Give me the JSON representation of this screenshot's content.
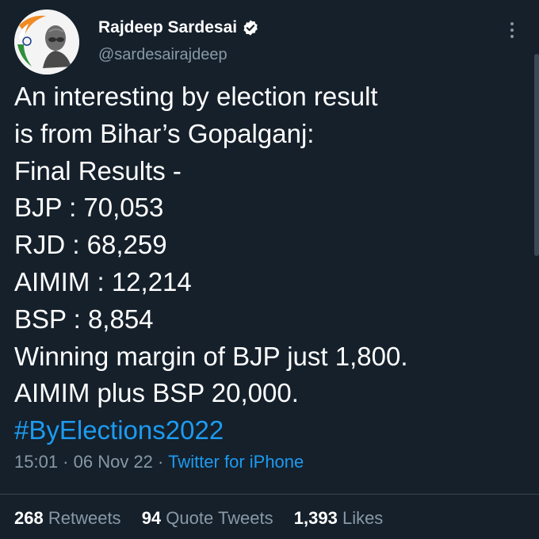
{
  "author": {
    "display_name": "Rajdeep Sardesai",
    "handle": "@sardesairajdeep",
    "verified_icon": "verified-badge-icon",
    "avatar": "profile-picture"
  },
  "tweet": {
    "lines": [
      "An interesting by election result",
      "is from Bihar’s Gopalganj:",
      "Final Results -",
      "BJP : 70,053",
      "RJD : 68,259",
      "AIMIM : 12,214",
      "BSP : 8,854",
      "Winning margin of BJP just 1,800.",
      "AIMIM plus BSP 20,000."
    ],
    "hashtag": "#ByElections2022"
  },
  "meta": {
    "time": "15:01",
    "separator": " · ",
    "date": "06 Nov 22",
    "source": "Twitter for iPhone"
  },
  "stats": {
    "retweets_count": "268",
    "retweets_label": "Retweets",
    "quotes_count": "94",
    "quotes_label": "Quote Tweets",
    "likes_count": "1,393",
    "likes_label": "Likes"
  },
  "colors": {
    "background": "#15202b",
    "text": "#ffffff",
    "secondary": "#8899a6",
    "link": "#1d9bf0"
  }
}
